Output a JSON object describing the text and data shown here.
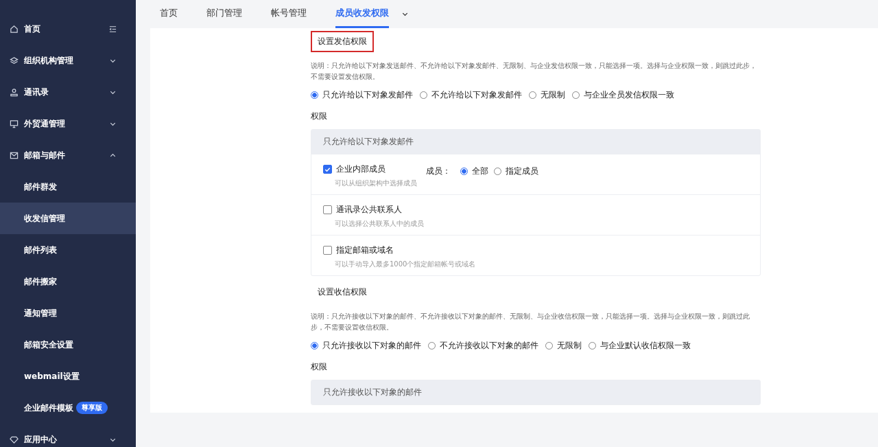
{
  "sidebar": {
    "items": [
      {
        "label": "首页",
        "kind": "home",
        "selected": false
      },
      {
        "label": "组织机构管理",
        "kind": "group",
        "expanded": false,
        "selected": false
      },
      {
        "label": "通讯录",
        "kind": "group",
        "expanded": false,
        "selected": false
      },
      {
        "label": "外贸通管理",
        "kind": "group",
        "expanded": false,
        "selected": false
      },
      {
        "label": "邮箱与邮件",
        "kind": "group",
        "expanded": true,
        "selected": false,
        "children": [
          {
            "label": "邮件群发",
            "selected": false
          },
          {
            "label": "收发信管理",
            "selected": true
          },
          {
            "label": "邮件列表",
            "selected": false
          },
          {
            "label": "邮件搬家",
            "selected": false
          },
          {
            "label": "通知管理",
            "selected": false
          },
          {
            "label": "邮箱安全设置",
            "selected": false
          },
          {
            "label": "webmail设置",
            "selected": false
          },
          {
            "label": "企业邮件模板",
            "badge": "尊享版",
            "selected": false
          }
        ]
      },
      {
        "label": "应用中心",
        "kind": "group",
        "expanded": false,
        "selected": false
      }
    ]
  },
  "tabs": [
    {
      "label": "首页",
      "selected": false
    },
    {
      "label": "部门管理",
      "selected": false
    },
    {
      "label": "帐号管理",
      "selected": false
    },
    {
      "label": "成员收发权限",
      "selected": true
    }
  ],
  "sections": [
    {
      "title": "设置发信权限",
      "highlighted": true,
      "note": "说明：只允许给以下对象发送邮件、不允许给以下对象发邮件、无限制、与企业发信权限一致，只能选择一项。选择与企业权限一致，则跳过此步，不需要设置发信权限。",
      "options": [
        {
          "label": "只允许给以下对象发邮件",
          "selected": true
        },
        {
          "label": "不允许给以下对象发邮件",
          "selected": false
        },
        {
          "label": "无限制",
          "selected": false
        },
        {
          "label": "与企业全员发信权限一致",
          "selected": false
        }
      ],
      "permission_label": "权限",
      "card_title": "只允许给以下对象发邮件",
      "rows": [
        {
          "label": "企业内部成员",
          "hint": "可以从组织架构中选择成员",
          "checked": true,
          "member_label": "成员：",
          "member_options": [
            {
              "label": "全部",
              "selected": true
            },
            {
              "label": "指定成员",
              "selected": false
            }
          ]
        },
        {
          "label": "通讯录公共联系人",
          "hint": "可以选择公共联系人中的成员",
          "checked": false
        },
        {
          "label": "指定邮箱或域名",
          "hint": "可以手动导入最多1000个指定邮箱帐号或域名",
          "checked": false
        }
      ]
    },
    {
      "title": "设置收信权限",
      "highlighted": false,
      "note": "说明：只允许接收以下对象的邮件、不允许接收以下对象的邮件、无限制、与企业收信权限一致，只能选择一项。选择与企业权限一致，则跳过此步，不需要设置收信权限。",
      "options": [
        {
          "label": "只允许接收以下对象的邮件",
          "selected": true
        },
        {
          "label": "不允许接收以下对象的邮件",
          "selected": false
        },
        {
          "label": "无限制",
          "selected": false
        },
        {
          "label": "与企业默认收信权限一致",
          "selected": false
        }
      ],
      "permission_label": "权限",
      "card_title": "只允许接收以下对象的邮件"
    }
  ]
}
